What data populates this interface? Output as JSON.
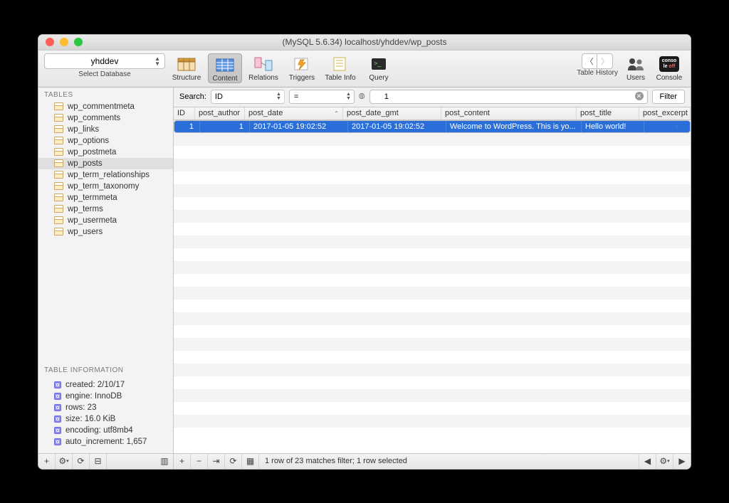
{
  "window_title": "(MySQL 5.6.34) localhost/yhddev/wp_posts",
  "db_select": {
    "value": "yhddev",
    "label": "Select Database"
  },
  "toolbar": {
    "structure": "Structure",
    "content": "Content",
    "relations": "Relations",
    "triggers": "Triggers",
    "tableinfo": "Table Info",
    "query": "Query",
    "history": "Table History",
    "users": "Users",
    "console": "Console"
  },
  "sidebar": {
    "tables_header": "TABLES",
    "tables": [
      "wp_commentmeta",
      "wp_comments",
      "wp_links",
      "wp_options",
      "wp_postmeta",
      "wp_posts",
      "wp_term_relationships",
      "wp_term_taxonomy",
      "wp_termmeta",
      "wp_terms",
      "wp_usermeta",
      "wp_users"
    ],
    "selected_table": "wp_posts",
    "info_header": "TABLE INFORMATION",
    "info": [
      "created: 2/10/17",
      "engine: InnoDB",
      "rows: 23",
      "size: 16.0 KiB",
      "encoding: utf8mb4",
      "auto_increment: 1,657"
    ]
  },
  "search": {
    "label": "Search:",
    "column": "ID",
    "operator": "=",
    "value": "1",
    "filter_btn": "Filter"
  },
  "grid": {
    "headers": [
      "ID",
      "post_author",
      "post_date",
      "post_date_gmt",
      "post_content",
      "post_title",
      "post_excerpt"
    ],
    "row": {
      "ID": "1",
      "post_author": "1",
      "post_date": "2017-01-05 19:02:52",
      "post_date_gmt": "2017-01-05 19:02:52",
      "post_content": "Welcome to WordPress. This is yo...",
      "post_title": "Hello world!",
      "post_excerpt": ""
    }
  },
  "status": "1 row of 23 matches filter; 1 row selected"
}
